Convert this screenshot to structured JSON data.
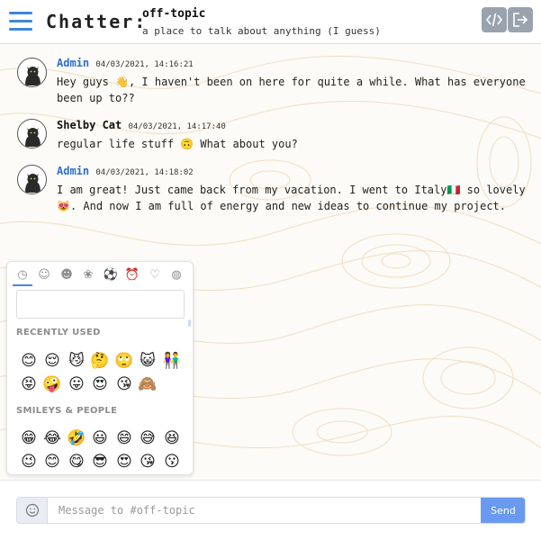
{
  "header": {
    "app_title": "Chatter:",
    "channel_name": "off-topic",
    "channel_description": "a place to talk about anything (I guess)",
    "buttons": [
      "code-icon",
      "logout-icon"
    ]
  },
  "messages": [
    {
      "author": "Admin",
      "role": "admin",
      "timestamp": "04/03/2021, 14:16:21",
      "text": "Hey guys 👋, I haven't been on here for quite a while. What has everyone been up to??"
    },
    {
      "author": "Shelby Cat",
      "role": "user",
      "timestamp": "04/03/2021, 14:17:40",
      "text": "regular life stuff 🙃 What about you?"
    },
    {
      "author": "Admin",
      "role": "admin",
      "timestamp": "04/03/2021, 14:18:02",
      "text": "I am great! Just came back from my vacation. I went to Italy🇮🇹 so lovely 😻. And now I am full of energy and new ideas to continue my project."
    }
  ],
  "emoji_picker": {
    "categories": [
      "recent-icon",
      "smileys-icon",
      "people-icon",
      "nature-icon",
      "sports-icon",
      "clock-icon",
      "heart-icon",
      "globe-icon"
    ],
    "category_glyphs": [
      "◷",
      "☺",
      "☻",
      "❀",
      "⚽",
      "⏰",
      "♡",
      "◍"
    ],
    "search_value": "",
    "sections": [
      {
        "title": "RECENTLY USED",
        "rows": [
          [
            "😊",
            "😌",
            "😼",
            "🤔",
            "🙄",
            "😺",
            "👫"
          ],
          [
            "😝",
            "🤪",
            "😛",
            "😍",
            "😘",
            "🙈"
          ]
        ]
      },
      {
        "title": "SMILEYS & PEOPLE",
        "rows": [
          [
            "😁",
            "😂",
            "🤣",
            "😃",
            "😄",
            "😅",
            "😆"
          ],
          [
            "😉",
            "😊",
            "😋",
            "😎",
            "😍",
            "😘",
            "😗"
          ]
        ]
      }
    ]
  },
  "composer": {
    "placeholder": "Message to #off-topic",
    "value": "",
    "send_label": "Send"
  },
  "colors": {
    "accent": "#3d87d6",
    "admin_name": "#2f6fd0",
    "send_button": "#6a9af0",
    "header_button": "#9aa3ad",
    "background": "#fdfbf7"
  }
}
